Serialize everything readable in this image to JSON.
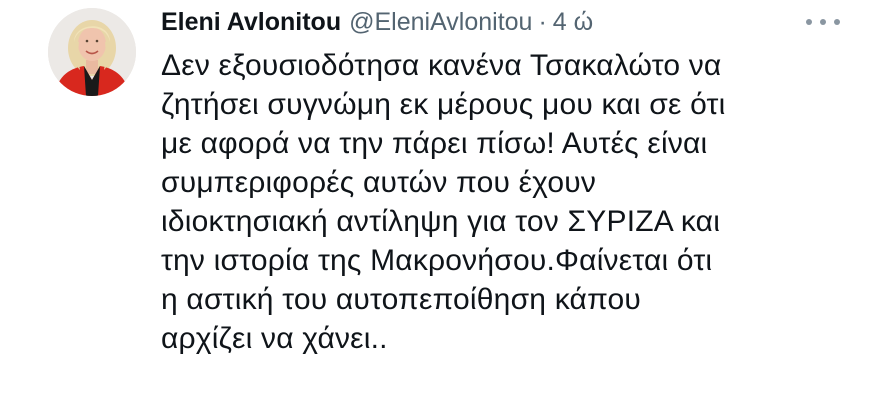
{
  "tweet": {
    "author": {
      "display_name": "Eleni Avlonitou",
      "handle": "@EleniAvlonitou",
      "avatar_icon": "profile-photo"
    },
    "separator": "·",
    "time": "4 ώ",
    "more_icon": "more-horizontal-icon",
    "lines": [
      "Δεν εξουσιοδότησα κανένα Τσακαλώτο να",
      "ζητήσει συγνώμη εκ μέρους μου και σε ότι",
      "με αφορά να την πάρει πίσω! Αυτές είναι",
      "συμπεριφορές αυτών που έχουν",
      "ιδιοκτησιακή αντίληψη για τον ΣΥΡΙΖΑ και",
      "την ιστορία της Μακρονήσου.Φαίνεται ότι",
      "η αστική του αυτοπεποίθηση κάπου",
      "αρχίζει να χάνει.."
    ]
  },
  "colors": {
    "primary_text": "#0f1419",
    "secondary_text": "#536471",
    "background": "#ffffff",
    "avatar_jacket": "#d8281e"
  }
}
